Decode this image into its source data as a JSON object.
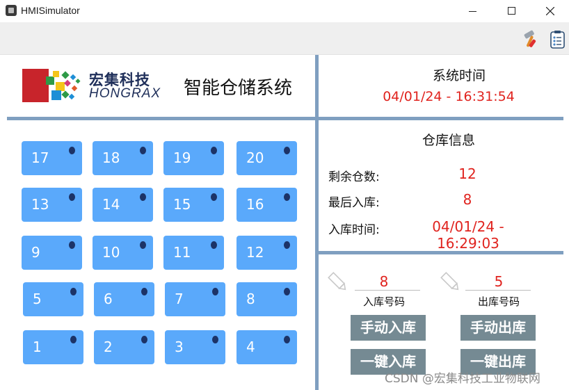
{
  "window": {
    "title": "HMISimulator"
  },
  "toolbar": {
    "icons": [
      "hammer-icon",
      "clipboard-icon"
    ]
  },
  "logo": {
    "cn": "宏集科技",
    "en": "HONGRAX"
  },
  "system": {
    "title": "智能仓储系统"
  },
  "time_panel": {
    "title": "系统时间",
    "value": "04/01/24 - 16:31:54"
  },
  "warehouse": {
    "title": "仓库信息",
    "remaining_label": "剩余仓数:",
    "remaining_value": "12",
    "last_in_label": "最后入库:",
    "last_in_value": "8",
    "in_time_label": "入库时间:",
    "in_time_value": "04/01/24 - 16:29:03"
  },
  "slots": [
    "17",
    "18",
    "19",
    "20",
    "13",
    "14",
    "15",
    "16",
    "9",
    "10",
    "11",
    "12",
    "5",
    "6",
    "7",
    "8",
    "1",
    "2",
    "3",
    "4"
  ],
  "controls": {
    "in_number": "8",
    "in_number_label": "入库号码",
    "out_number": "5",
    "out_number_label": "出库号码",
    "manual_in": "手动入库",
    "manual_out": "手动出库",
    "oneclick_in": "一键入库",
    "oneclick_out": "一键出库"
  },
  "watermark": "CSDN @宏集科技工业物联网",
  "colors": {
    "slot": "#5aa9fb",
    "separator": "#7f9fc0",
    "value_red": "#e0231e",
    "button": "#758a93"
  }
}
